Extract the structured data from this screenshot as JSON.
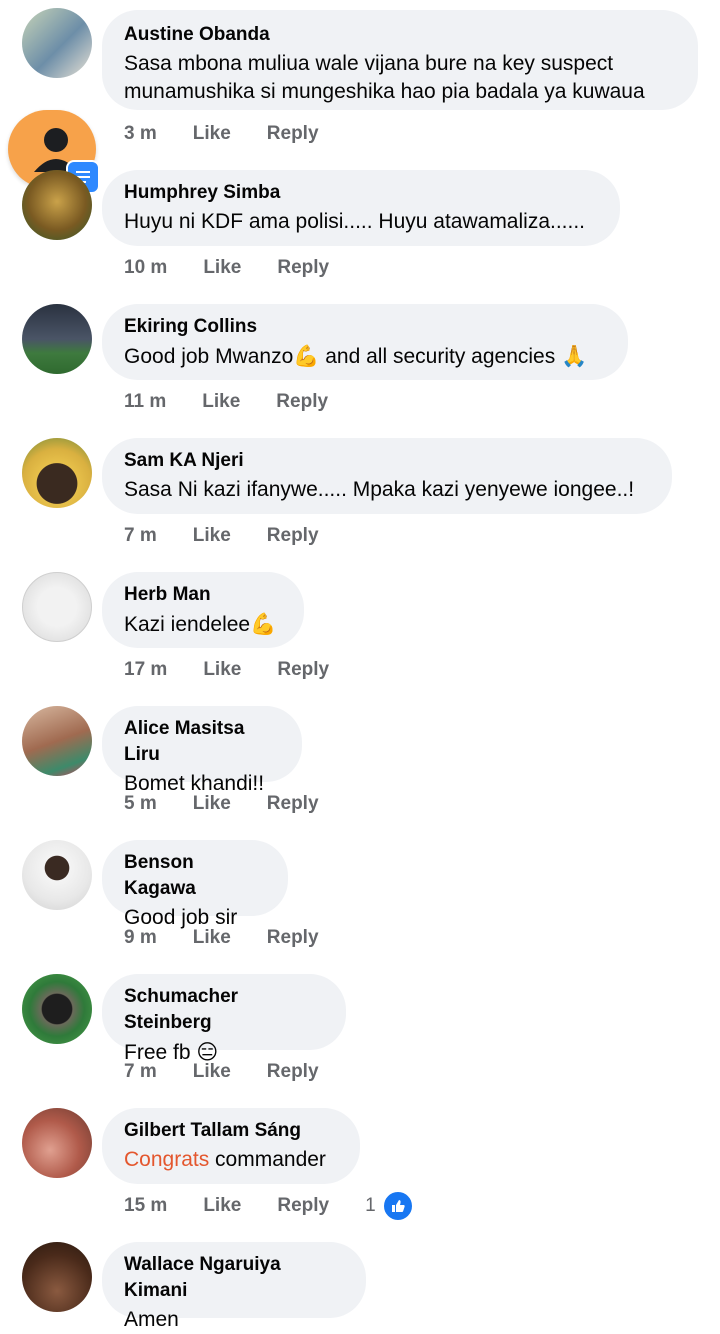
{
  "comments": [
    {
      "name": "Austine Obanda",
      "lines": [
        "Sasa mbona muliua wale vijana bure na key suspect",
        "munamushika si mungeshika hao pia badala ya kuwaua"
      ],
      "time": "3 m",
      "like": "Like",
      "reply": "Reply"
    },
    {
      "name": "Humphrey Simba",
      "text": "Huyu ni KDF ama polisi..... Huyu atawamaliza......",
      "time": "10 m",
      "like": "Like",
      "reply": "Reply"
    },
    {
      "name": "Ekiring Collins",
      "text": "Good job Mwanzo",
      "text2": " and all security agencies ",
      "emoji1": "💪",
      "emoji2": "🙏",
      "time": "11 m",
      "like": "Like",
      "reply": "Reply"
    },
    {
      "name": "Sam KA Njeri",
      "text": "Sasa Ni kazi ifanywe..... Mpaka kazi yenyewe iongee..!",
      "time": "7 m",
      "like": "Like",
      "reply": "Reply"
    },
    {
      "name": "Herb Man",
      "text": "Kazi iendelee",
      "emoji1": "💪",
      "time": "17 m",
      "like": "Like",
      "reply": "Reply"
    },
    {
      "name": "Alice Masitsa Liru",
      "text": "Bomet khandi!!",
      "time": "5 m",
      "like": "Like",
      "reply": "Reply"
    },
    {
      "name": "Benson Kagawa",
      "text": "Good job sir",
      "time": "9 m",
      "like": "Like",
      "reply": "Reply"
    },
    {
      "name": "Schumacher Steinberg",
      "text": "Free fb ",
      "emoji1": "😑",
      "time": "7 m",
      "like": "Like",
      "reply": "Reply"
    },
    {
      "name": "Gilbert Tallam Sáng",
      "highlight": "Congrats",
      "text": " commander",
      "time": "15 m",
      "like": "Like",
      "reply": "Reply",
      "reaction_count": "1"
    },
    {
      "name": "Wallace Ngaruiya Kimani",
      "text": "Amen"
    }
  ],
  "colors": {
    "bubble": "#f0f2f5",
    "meta": "#65676b",
    "accent": "#1877f2",
    "highlight": "#e4572e",
    "fab": "#f7a24a"
  },
  "icons": {
    "fab": "user-icon",
    "fab_badge": "message-icon",
    "reaction": "thumbs-up-icon"
  }
}
